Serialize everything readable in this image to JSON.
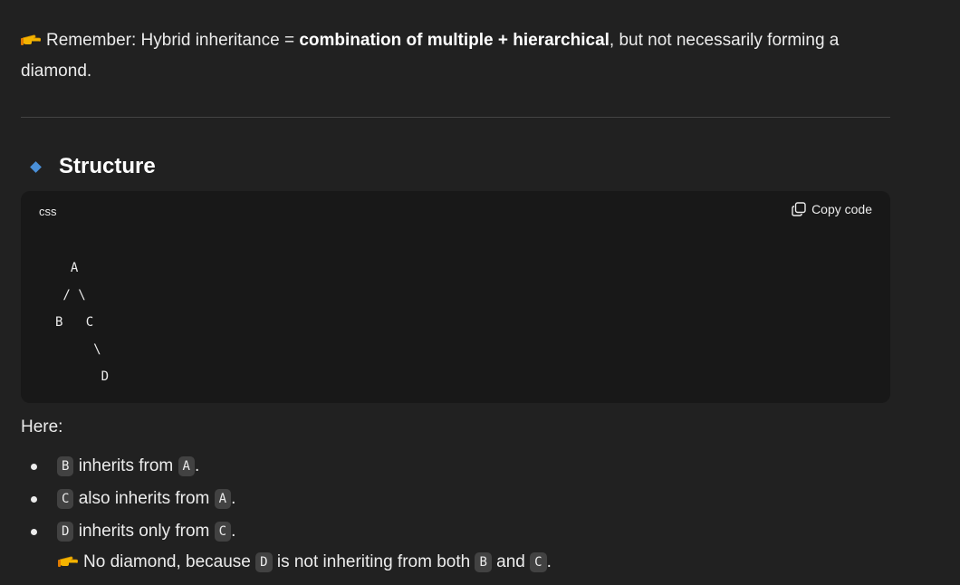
{
  "remember": {
    "prefix": "Remember: Hybrid inheritance = ",
    "bold": "combination of multiple + hierarchical",
    "suffix": ", but not necessarily forming a diamond.",
    "icon": "pointing-hand-icon"
  },
  "structure": {
    "heading": "Structure",
    "heading_icon": "blue-diamond-icon",
    "accent": "#4a90d9"
  },
  "code_block": {
    "language": "css",
    "copy_label": "Copy code",
    "copy_icon": "copy-icon",
    "code": "  A\n / \\\nB   C\n     \\\n      D"
  },
  "explanation": {
    "intro": "Here:",
    "items": [
      {
        "code": "B",
        "text": " inherits from ",
        "code2": "A",
        "end": "."
      },
      {
        "code": "C",
        "text": " also inherits from ",
        "code2": "A",
        "end": "."
      },
      {
        "code": "D",
        "text": " inherits only from ",
        "code2": "C",
        "end": "."
      }
    ],
    "note": {
      "icon": "pointing-hand-icon",
      "prefix": "No diamond, because ",
      "code1": "D",
      "middle": " is not inheriting from both ",
      "code2": "B",
      "and": " and ",
      "code3": "C",
      "end": "."
    }
  }
}
